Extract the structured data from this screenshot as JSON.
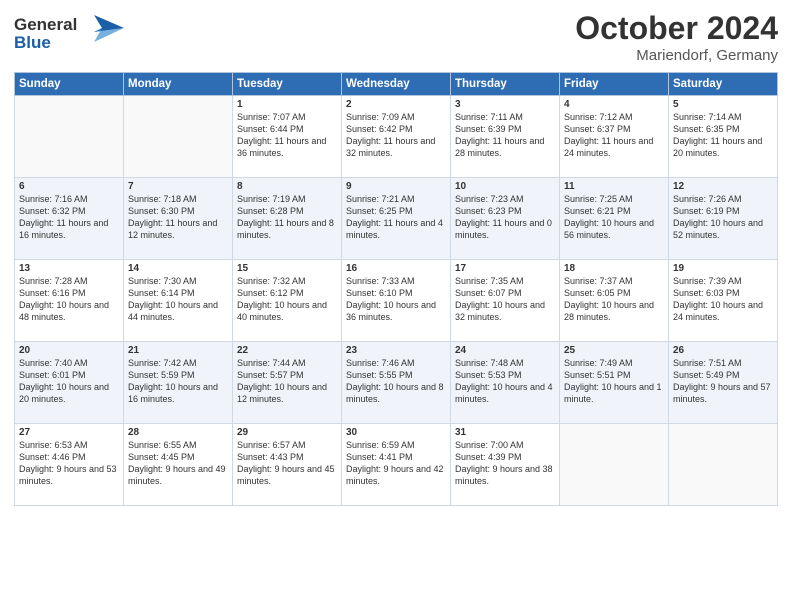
{
  "header": {
    "logo_line1": "General",
    "logo_line2": "Blue",
    "month": "October 2024",
    "location": "Mariendorf, Germany"
  },
  "weekdays": [
    "Sunday",
    "Monday",
    "Tuesday",
    "Wednesday",
    "Thursday",
    "Friday",
    "Saturday"
  ],
  "weeks": [
    [
      {
        "day": "",
        "info": ""
      },
      {
        "day": "",
        "info": ""
      },
      {
        "day": "1",
        "info": "Sunrise: 7:07 AM\nSunset: 6:44 PM\nDaylight: 11 hours and 36 minutes."
      },
      {
        "day": "2",
        "info": "Sunrise: 7:09 AM\nSunset: 6:42 PM\nDaylight: 11 hours and 32 minutes."
      },
      {
        "day": "3",
        "info": "Sunrise: 7:11 AM\nSunset: 6:39 PM\nDaylight: 11 hours and 28 minutes."
      },
      {
        "day": "4",
        "info": "Sunrise: 7:12 AM\nSunset: 6:37 PM\nDaylight: 11 hours and 24 minutes."
      },
      {
        "day": "5",
        "info": "Sunrise: 7:14 AM\nSunset: 6:35 PM\nDaylight: 11 hours and 20 minutes."
      }
    ],
    [
      {
        "day": "6",
        "info": "Sunrise: 7:16 AM\nSunset: 6:32 PM\nDaylight: 11 hours and 16 minutes."
      },
      {
        "day": "7",
        "info": "Sunrise: 7:18 AM\nSunset: 6:30 PM\nDaylight: 11 hours and 12 minutes."
      },
      {
        "day": "8",
        "info": "Sunrise: 7:19 AM\nSunset: 6:28 PM\nDaylight: 11 hours and 8 minutes."
      },
      {
        "day": "9",
        "info": "Sunrise: 7:21 AM\nSunset: 6:25 PM\nDaylight: 11 hours and 4 minutes."
      },
      {
        "day": "10",
        "info": "Sunrise: 7:23 AM\nSunset: 6:23 PM\nDaylight: 11 hours and 0 minutes."
      },
      {
        "day": "11",
        "info": "Sunrise: 7:25 AM\nSunset: 6:21 PM\nDaylight: 10 hours and 56 minutes."
      },
      {
        "day": "12",
        "info": "Sunrise: 7:26 AM\nSunset: 6:19 PM\nDaylight: 10 hours and 52 minutes."
      }
    ],
    [
      {
        "day": "13",
        "info": "Sunrise: 7:28 AM\nSunset: 6:16 PM\nDaylight: 10 hours and 48 minutes."
      },
      {
        "day": "14",
        "info": "Sunrise: 7:30 AM\nSunset: 6:14 PM\nDaylight: 10 hours and 44 minutes."
      },
      {
        "day": "15",
        "info": "Sunrise: 7:32 AM\nSunset: 6:12 PM\nDaylight: 10 hours and 40 minutes."
      },
      {
        "day": "16",
        "info": "Sunrise: 7:33 AM\nSunset: 6:10 PM\nDaylight: 10 hours and 36 minutes."
      },
      {
        "day": "17",
        "info": "Sunrise: 7:35 AM\nSunset: 6:07 PM\nDaylight: 10 hours and 32 minutes."
      },
      {
        "day": "18",
        "info": "Sunrise: 7:37 AM\nSunset: 6:05 PM\nDaylight: 10 hours and 28 minutes."
      },
      {
        "day": "19",
        "info": "Sunrise: 7:39 AM\nSunset: 6:03 PM\nDaylight: 10 hours and 24 minutes."
      }
    ],
    [
      {
        "day": "20",
        "info": "Sunrise: 7:40 AM\nSunset: 6:01 PM\nDaylight: 10 hours and 20 minutes."
      },
      {
        "day": "21",
        "info": "Sunrise: 7:42 AM\nSunset: 5:59 PM\nDaylight: 10 hours and 16 minutes."
      },
      {
        "day": "22",
        "info": "Sunrise: 7:44 AM\nSunset: 5:57 PM\nDaylight: 10 hours and 12 minutes."
      },
      {
        "day": "23",
        "info": "Sunrise: 7:46 AM\nSunset: 5:55 PM\nDaylight: 10 hours and 8 minutes."
      },
      {
        "day": "24",
        "info": "Sunrise: 7:48 AM\nSunset: 5:53 PM\nDaylight: 10 hours and 4 minutes."
      },
      {
        "day": "25",
        "info": "Sunrise: 7:49 AM\nSunset: 5:51 PM\nDaylight: 10 hours and 1 minute."
      },
      {
        "day": "26",
        "info": "Sunrise: 7:51 AM\nSunset: 5:49 PM\nDaylight: 9 hours and 57 minutes."
      }
    ],
    [
      {
        "day": "27",
        "info": "Sunrise: 6:53 AM\nSunset: 4:46 PM\nDaylight: 9 hours and 53 minutes."
      },
      {
        "day": "28",
        "info": "Sunrise: 6:55 AM\nSunset: 4:45 PM\nDaylight: 9 hours and 49 minutes."
      },
      {
        "day": "29",
        "info": "Sunrise: 6:57 AM\nSunset: 4:43 PM\nDaylight: 9 hours and 45 minutes."
      },
      {
        "day": "30",
        "info": "Sunrise: 6:59 AM\nSunset: 4:41 PM\nDaylight: 9 hours and 42 minutes."
      },
      {
        "day": "31",
        "info": "Sunrise: 7:00 AM\nSunset: 4:39 PM\nDaylight: 9 hours and 38 minutes."
      },
      {
        "day": "",
        "info": ""
      },
      {
        "day": "",
        "info": ""
      }
    ]
  ]
}
